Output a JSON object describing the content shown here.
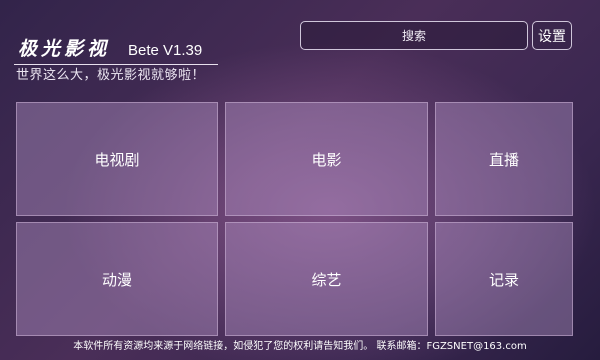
{
  "header": {
    "app_name": "极光影视",
    "version": "Bete V1.39",
    "tagline": "世界这么大，极光影视就够啦！"
  },
  "search": {
    "label": "搜索"
  },
  "settings": {
    "label": "设置"
  },
  "categories": [
    {
      "label": "电视剧"
    },
    {
      "label": "电影"
    },
    {
      "label": "直播"
    },
    {
      "label": "动漫"
    },
    {
      "label": "综艺"
    },
    {
      "label": "记录"
    }
  ],
  "footer": {
    "notice": "本软件所有资源均来源于网络链接，如侵犯了您的权利请告知我们。 联系邮箱：FGZSNET@163.com"
  }
}
